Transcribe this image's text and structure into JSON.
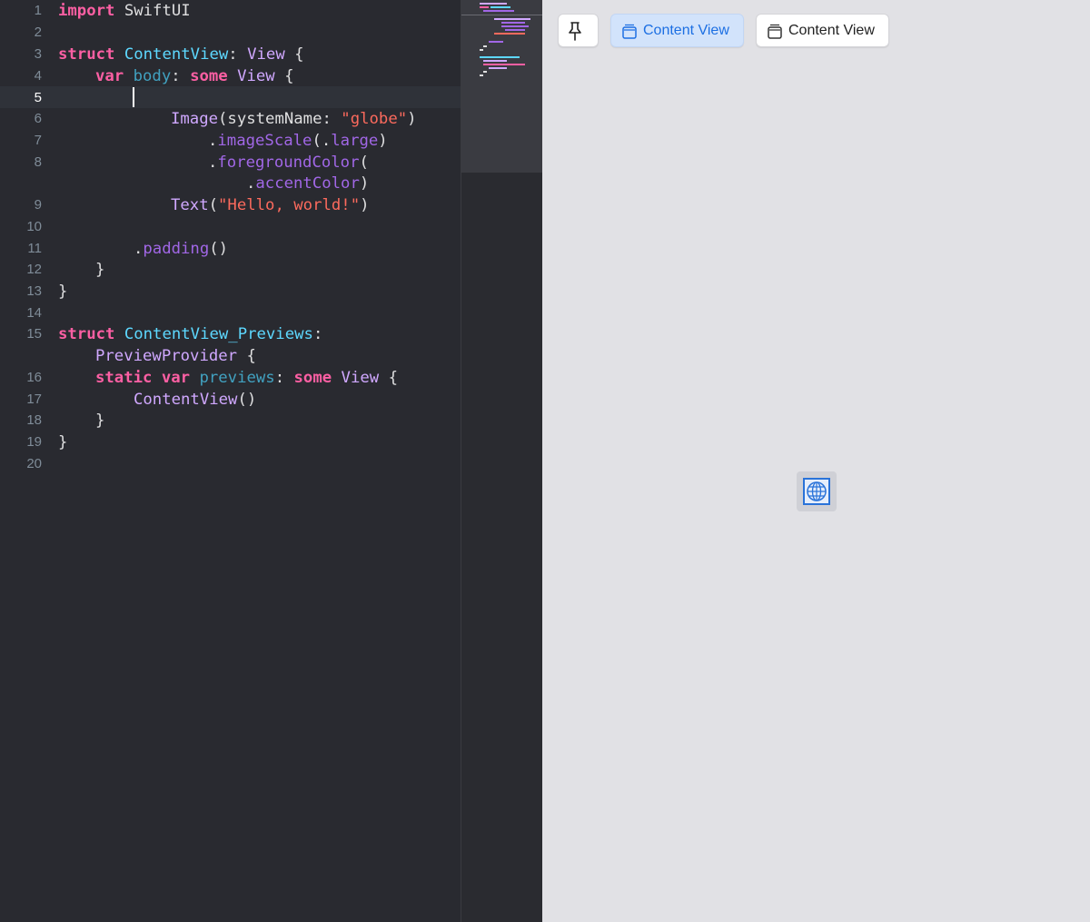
{
  "editor": {
    "current_line": "5",
    "line_numbers": [
      "1",
      "2",
      "3",
      "4",
      "5",
      "6",
      "7",
      "8",
      "9",
      "10",
      "11",
      "12",
      "13",
      "14",
      "15",
      "16",
      "17",
      "18",
      "19",
      "20"
    ],
    "code": {
      "l1": {
        "kw": "import",
        "pl": " SwiftUI"
      },
      "l3": {
        "kw": "struct",
        "ty": "ContentView",
        "p1": ": ",
        "sy": "View",
        "p2": " {"
      },
      "l4": {
        "kw1": "var",
        "pr": "body",
        "p1": ": ",
        "kw2": "some",
        "sy": "View",
        "p2": " {"
      },
      "l6": {
        "sy": "Image",
        "p1": "(systemName: ",
        "st": "\"globe\"",
        "p2": ")"
      },
      "l7": {
        "p1": ".",
        "me": "imageScale",
        "p2": "(.",
        "me2": "large",
        "p3": ")"
      },
      "l8": {
        "p1": ".",
        "me": "foregroundColor",
        "p2": "("
      },
      "l8b": {
        "p1": ".",
        "me": "accentColor",
        "p2": ")"
      },
      "l9": {
        "sy": "Text",
        "p1": "(",
        "st": "\"Hello, world!\"",
        "p2": ")"
      },
      "l11": {
        "p1": ".",
        "me": "padding",
        "p2": "()"
      },
      "l12": {
        "pl": "}"
      },
      "l13": {
        "pl": "}"
      },
      "l15": {
        "kw": "struct",
        "ty": "ContentView_Previews",
        "p1": ":"
      },
      "l15b": {
        "sy": "PreviewProvider",
        "p1": " {"
      },
      "l16": {
        "kw1": "static",
        "kw2": "var",
        "pr": "previews",
        "p1": ": ",
        "kw3": "some",
        "sy": "View",
        "p2": " {"
      },
      "l17": {
        "sy": "ContentView",
        "p1": "()"
      },
      "l18": {
        "pl": "}"
      },
      "l19": {
        "pl": "}"
      }
    }
  },
  "preview": {
    "pin_icon": "pin-icon",
    "buttons": [
      {
        "label": "Content View",
        "icon": "window-icon",
        "selected": true
      },
      {
        "label": "Content View",
        "icon": "window-icon",
        "selected": false
      }
    ],
    "content_icon": "globe-icon",
    "accent": "#1c6fe3"
  },
  "colors": {
    "editor_bg": "#292a30",
    "keyword": "#fc5fa3",
    "type_decl": "#5dd8ff",
    "type_ref": "#d0a8ff",
    "string": "#fc6a5d",
    "method": "#a167e6",
    "property": "#41a1c0",
    "preview_bg": "#e1e1e5"
  }
}
